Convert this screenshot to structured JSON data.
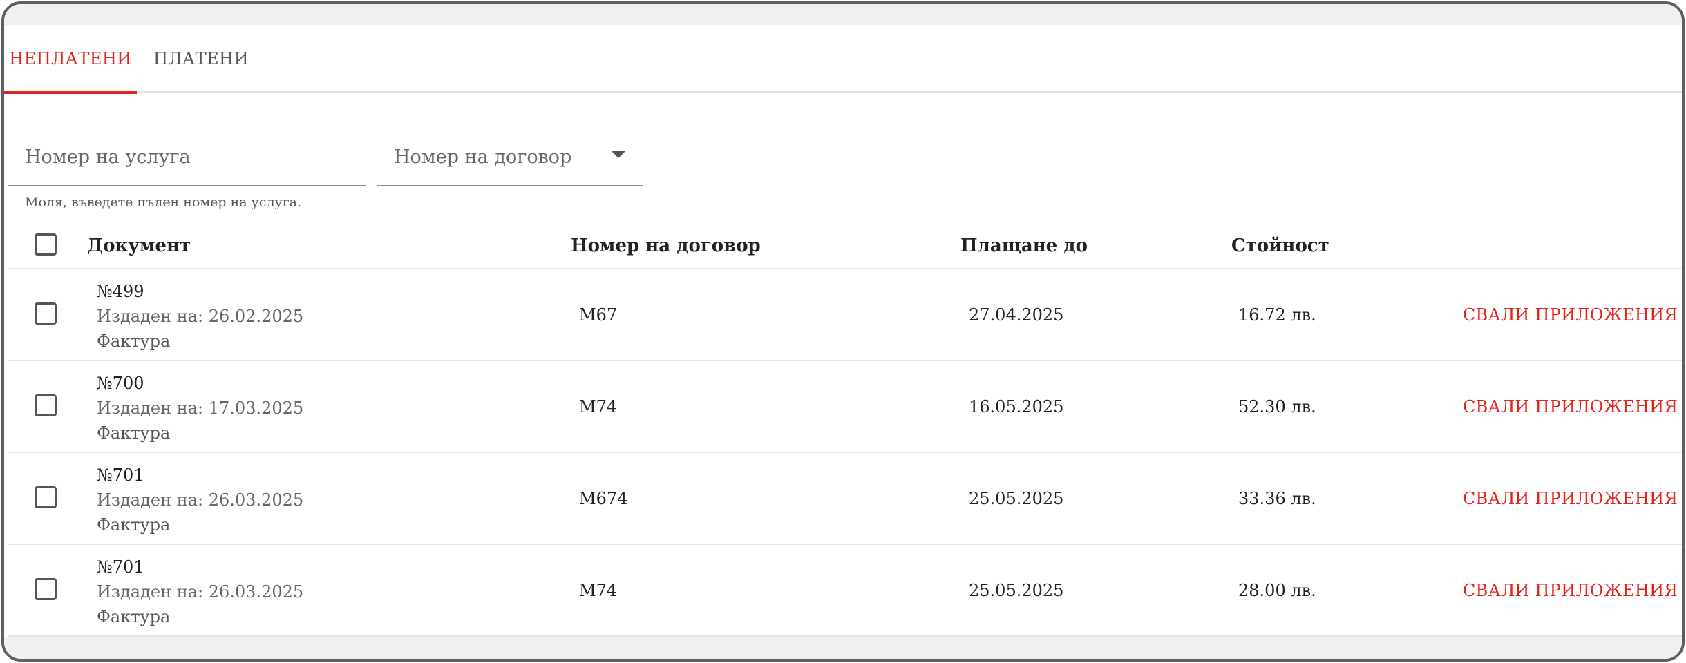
{
  "tabs": [
    {
      "label": "НЕПЛАТЕНИ",
      "active": true
    },
    {
      "label": "ПЛАТЕНИ",
      "active": false
    }
  ],
  "filters": {
    "service_placeholder": "Номер на услуга",
    "service_hint": "Моля, въведете пълен номер на услуга.",
    "contract_placeholder": "Номер на договор"
  },
  "table": {
    "headers": {
      "document": "Документ",
      "contract": "Номер на договор",
      "due": "Плащане до",
      "amount": "Стойност"
    },
    "action_label": "СВАЛИ ПРИЛОЖЕНИЯ",
    "rows": [
      {
        "number": "№499",
        "issued": "Издаден на: 26.02.2025",
        "type": "Фактура",
        "contract": "M67",
        "due": "27.04.2025",
        "amount": "16.72 лв."
      },
      {
        "number": "№700",
        "issued": "Издаден на: 17.03.2025",
        "type": "Фактура",
        "contract": "M74",
        "due": "16.05.2025",
        "amount": "52.30 лв."
      },
      {
        "number": "№701",
        "issued": "Издаден на: 26.03.2025",
        "type": "Фактура",
        "contract": "M674",
        "due": "25.05.2025",
        "amount": "33.36 лв."
      },
      {
        "number": "№701",
        "issued": "Издаден на: 26.03.2025",
        "type": "Фактура",
        "contract": "M74",
        "due": "25.05.2025",
        "amount": "28.00 лв."
      }
    ]
  },
  "colors": {
    "accent": "#e2231a",
    "border": "#5f5f5f",
    "band": "#f0f0f0"
  }
}
